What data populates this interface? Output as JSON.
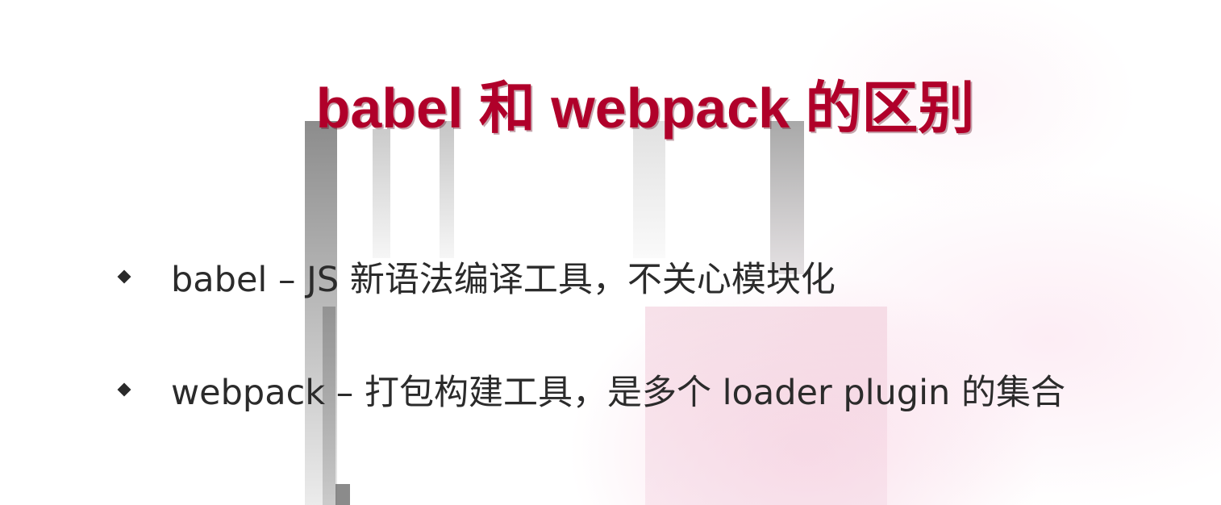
{
  "slide": {
    "title": "babel 和 webpack 的区别",
    "bullets": [
      {
        "text": "babel – JS 新语法编译工具，不关心模块化",
        "icon": "diamond-bullet-icon"
      },
      {
        "text": "webpack – 打包构建工具，是多个 loader plugin 的集合",
        "icon": "diamond-bullet-icon"
      }
    ]
  },
  "colors": {
    "title": "#b0002a",
    "body_text": "#2b2b2b",
    "background": "#ffffff",
    "accent_tint": "#f6c8dc"
  }
}
